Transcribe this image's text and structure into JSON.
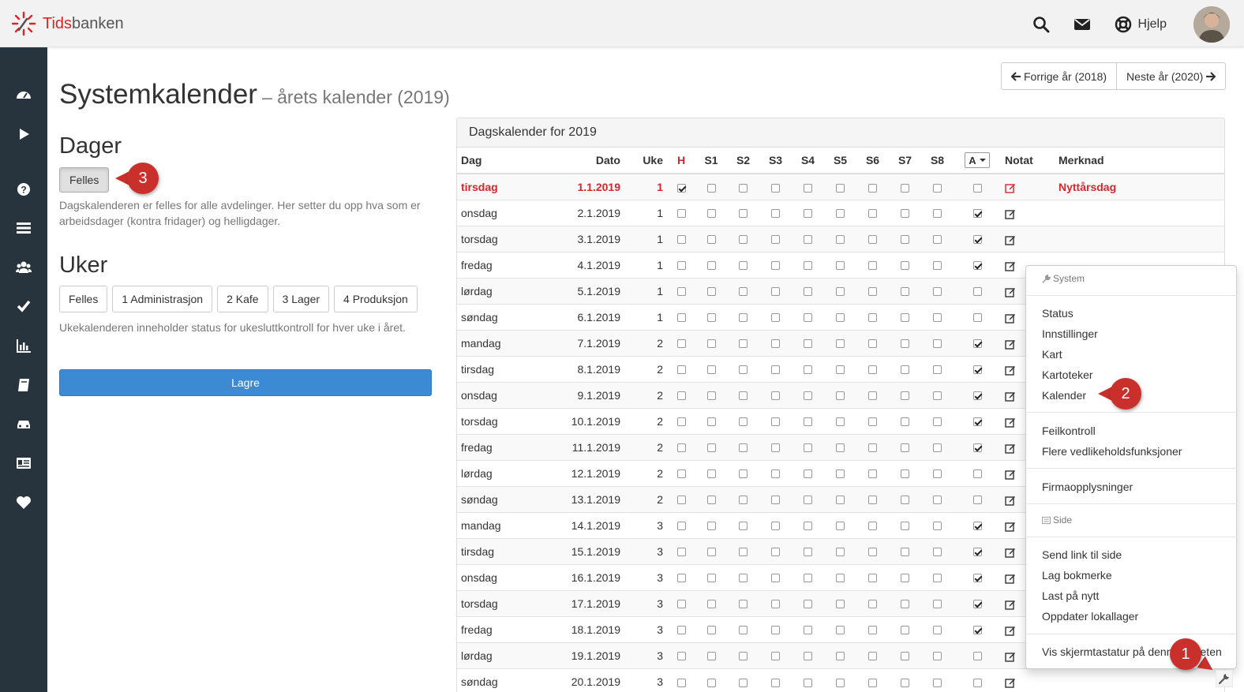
{
  "app": {
    "logo_part1": "Tids",
    "logo_part2": "banken",
    "help_label": "Hjelp",
    "brand_color": "#d9262b"
  },
  "sidebar": {
    "icons": [
      "dashboard-icon",
      "play-icon",
      "question-icon",
      "list-icon",
      "users-icon",
      "check-icon",
      "bar-chart-icon",
      "book-icon",
      "car-icon",
      "id-card-icon",
      "heart-icon"
    ]
  },
  "page": {
    "title": "Systemkalender",
    "subtitle": "– årets kalender (2019)",
    "prev_year": "Forrige år (2018)",
    "next_year": "Neste år (2020)"
  },
  "left": {
    "dager_heading": "Dager",
    "felles_button": "Felles",
    "dager_help": "Dagskalenderen er felles for alle avdelinger. Her setter du opp hva som er arbeidsdager (kontra fridager) og helligdager.",
    "uker_heading": "Uker",
    "week_buttons": [
      "Felles",
      "1 Administrasjon",
      "2 Kafe",
      "3 Lager",
      "4 Produksjon"
    ],
    "uker_help": "Ukekalenderen inneholder status for ukesluttkontroll for hver uke i året.",
    "save_button": "Lagre"
  },
  "panel": {
    "title": "Dagskalender for 2019",
    "headers": {
      "dag": "Dag",
      "dato": "Dato",
      "uke": "Uke",
      "h": "H",
      "s1": "S1",
      "s2": "S2",
      "s3": "S3",
      "s4": "S4",
      "s5": "S5",
      "s6": "S6",
      "s7": "S7",
      "s8": "S8",
      "a": "A",
      "notat": "Notat",
      "merknad": "Merknad"
    },
    "rows": [
      {
        "dag": "tirsdag",
        "dato": "1.1.2019",
        "uke": "1",
        "h": true,
        "a": false,
        "merknad": "Nyttårsdag",
        "holiday": true
      },
      {
        "dag": "onsdag",
        "dato": "2.1.2019",
        "uke": "1",
        "h": false,
        "a": true,
        "merknad": ""
      },
      {
        "dag": "torsdag",
        "dato": "3.1.2019",
        "uke": "1",
        "h": false,
        "a": true,
        "merknad": ""
      },
      {
        "dag": "fredag",
        "dato": "4.1.2019",
        "uke": "1",
        "h": false,
        "a": true,
        "merknad": ""
      },
      {
        "dag": "lørdag",
        "dato": "5.1.2019",
        "uke": "1",
        "h": false,
        "a": false,
        "merknad": ""
      },
      {
        "dag": "søndag",
        "dato": "6.1.2019",
        "uke": "1",
        "h": false,
        "a": false,
        "merknad": ""
      },
      {
        "dag": "mandag",
        "dato": "7.1.2019",
        "uke": "2",
        "h": false,
        "a": true,
        "merknad": ""
      },
      {
        "dag": "tirsdag",
        "dato": "8.1.2019",
        "uke": "2",
        "h": false,
        "a": true,
        "merknad": ""
      },
      {
        "dag": "onsdag",
        "dato": "9.1.2019",
        "uke": "2",
        "h": false,
        "a": true,
        "merknad": ""
      },
      {
        "dag": "torsdag",
        "dato": "10.1.2019",
        "uke": "2",
        "h": false,
        "a": true,
        "merknad": ""
      },
      {
        "dag": "fredag",
        "dato": "11.1.2019",
        "uke": "2",
        "h": false,
        "a": true,
        "merknad": ""
      },
      {
        "dag": "lørdag",
        "dato": "12.1.2019",
        "uke": "2",
        "h": false,
        "a": false,
        "merknad": ""
      },
      {
        "dag": "søndag",
        "dato": "13.1.2019",
        "uke": "2",
        "h": false,
        "a": false,
        "merknad": ""
      },
      {
        "dag": "mandag",
        "dato": "14.1.2019",
        "uke": "3",
        "h": false,
        "a": true,
        "merknad": ""
      },
      {
        "dag": "tirsdag",
        "dato": "15.1.2019",
        "uke": "3",
        "h": false,
        "a": true,
        "merknad": ""
      },
      {
        "dag": "onsdag",
        "dato": "16.1.2019",
        "uke": "3",
        "h": false,
        "a": true,
        "merknad": ""
      },
      {
        "dag": "torsdag",
        "dato": "17.1.2019",
        "uke": "3",
        "h": false,
        "a": true,
        "merknad": ""
      },
      {
        "dag": "fredag",
        "dato": "18.1.2019",
        "uke": "3",
        "h": false,
        "a": true,
        "merknad": ""
      },
      {
        "dag": "lørdag",
        "dato": "19.1.2019",
        "uke": "3",
        "h": false,
        "a": false,
        "merknad": ""
      },
      {
        "dag": "søndag",
        "dato": "20.1.2019",
        "uke": "3",
        "h": false,
        "a": false,
        "merknad": ""
      }
    ]
  },
  "dropdown": {
    "header_system": "System",
    "group1": [
      "Status",
      "Innstillinger",
      "Kart",
      "Kartoteker",
      "Kalender"
    ],
    "group2": [
      "Feilkontroll",
      "Flere vedlikeholdsfunksjoner"
    ],
    "group3": [
      "Firmaopplysninger"
    ],
    "header_side": "Side",
    "group4": [
      "Send link til side",
      "Lag bokmerke",
      "Last på nytt",
      "Oppdater lokallager"
    ],
    "group5": [
      "Vis skjermtastatur på denne enheten"
    ]
  },
  "callouts": {
    "one": "1",
    "two": "2",
    "three": "3",
    "color": "#c9302c"
  }
}
